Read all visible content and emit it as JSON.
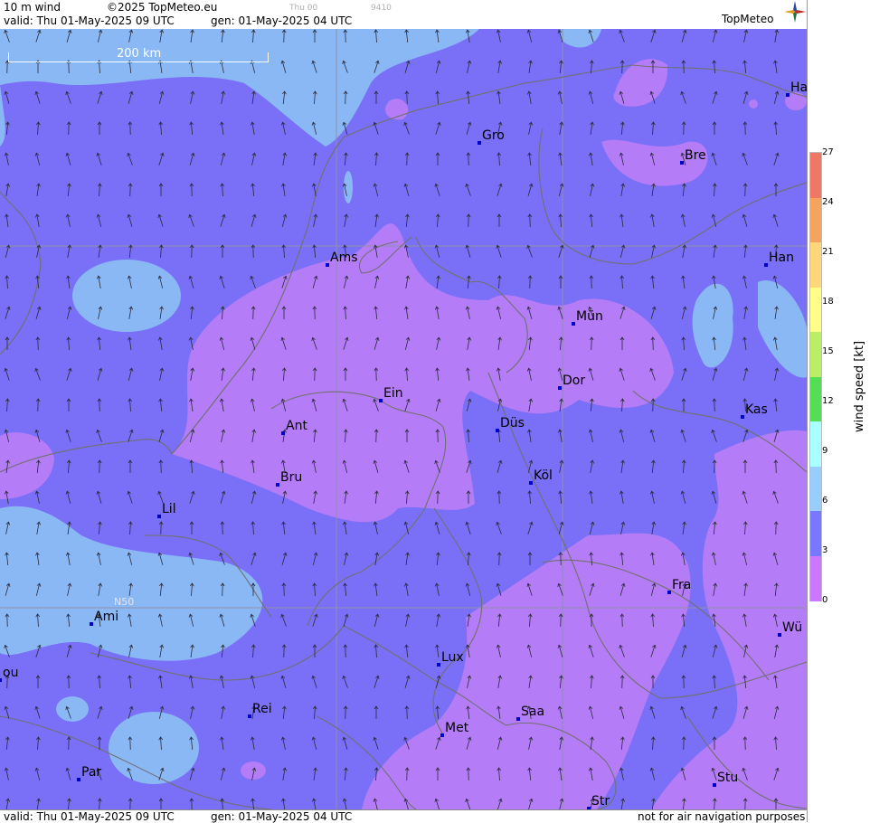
{
  "header": {
    "product": "10 m wind",
    "copyright": "©2025 TopMeteo.eu",
    "valid": "valid:  Thu  01-May-2025  09 UTC",
    "generated": "gen: 01-May-2025 04 UTC",
    "faint_day": "Thu 00",
    "faint_code": "9410"
  },
  "logo": {
    "text": "TopMeteo"
  },
  "footer": {
    "valid": "valid:  Thu  01-May-2025  09 UTC",
    "generated": "gen: 01-May-2025 04 UTC",
    "disclaimer": "not for air navigation purposes"
  },
  "map": {
    "scale_label": "200 km",
    "lat_label": "N50",
    "cities": [
      {
        "code": "Gro"
      },
      {
        "code": "Bre"
      },
      {
        "code": "Ha"
      },
      {
        "code": "Ams"
      },
      {
        "code": "Han"
      },
      {
        "code": "Mün"
      },
      {
        "code": "Dor"
      },
      {
        "code": "Ein"
      },
      {
        "code": "Ant"
      },
      {
        "code": "Düs"
      },
      {
        "code": "Kas"
      },
      {
        "code": "Bru"
      },
      {
        "code": "Köl"
      },
      {
        "code": "Lil"
      },
      {
        "code": "Fra"
      },
      {
        "code": "Ami"
      },
      {
        "code": "Wü"
      },
      {
        "code": "Lux"
      },
      {
        "code": "ou"
      },
      {
        "code": "Rei"
      },
      {
        "code": "Saa"
      },
      {
        "code": "Met"
      },
      {
        "code": "Par"
      },
      {
        "code": "Stu"
      },
      {
        "code": "Str"
      }
    ]
  },
  "legend": {
    "title": "wind speed [kt]",
    "ticks": [
      "27",
      "24",
      "21",
      "18",
      "15",
      "12",
      "9",
      "6",
      "3",
      "0"
    ],
    "colors": [
      "#ee7766",
      "#f5a460",
      "#ffd77a",
      "#ffff88",
      "#bbee66",
      "#55dd55",
      "#aaffff",
      "#99ccff",
      "#7777ff",
      "#cc77ff"
    ]
  }
}
